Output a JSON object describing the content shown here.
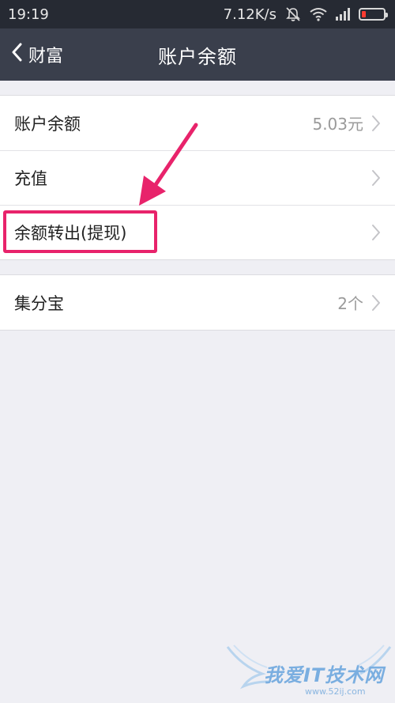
{
  "status_bar": {
    "time": "19:19",
    "speed": "7.12K/s",
    "icons": [
      "mute-icon",
      "wifi-icon",
      "signal-icon",
      "battery-icon"
    ],
    "battery_color": "#ff3b30"
  },
  "nav": {
    "back_label": "财富",
    "title": "账户余额"
  },
  "groups": [
    {
      "rows": [
        {
          "label": "账户余额",
          "value": "5.03元"
        },
        {
          "label": "充值",
          "value": ""
        },
        {
          "label": "余额转出(提现)",
          "value": ""
        }
      ]
    },
    {
      "rows": [
        {
          "label": "集分宝",
          "value": "2个"
        }
      ]
    }
  ],
  "annotation": {
    "highlight_color": "#e8236b"
  },
  "watermark": {
    "text": "我爱IT技术网",
    "url": "www.52ij.com"
  }
}
